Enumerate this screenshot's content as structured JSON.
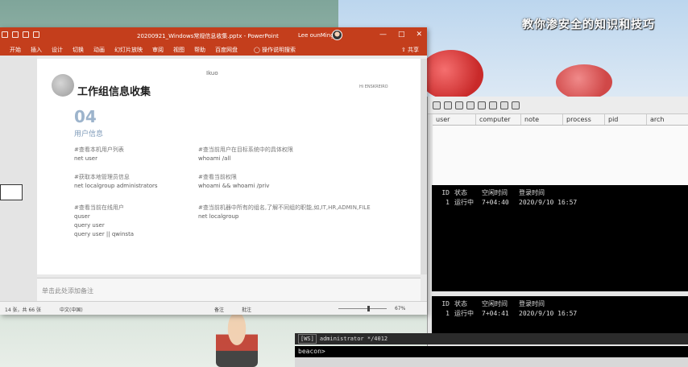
{
  "watermark": "教你渗安全的知识和技巧",
  "powerpoint": {
    "title": "20200921_Windows常规信息收集.pptx - PowerPoint",
    "user": "Lee ounMing",
    "window_controls": [
      "—",
      "□",
      "✕"
    ],
    "ribbon_tabs": [
      "开始",
      "插入",
      "设计",
      "切换",
      "动画",
      "幻灯片放映",
      "审阅",
      "视图",
      "帮助",
      "百度网盘"
    ],
    "search": "操作说明搜索",
    "share": "共享",
    "slide": {
      "heading": "工作组信息收集",
      "number": "04",
      "subtitle": "用户信息",
      "cursor_text": "Ikuo",
      "logo_text": "Hi ENSKREIRO",
      "sections": [
        {
          "title": "#查看本机用户列表",
          "lines": [
            "net user"
          ]
        },
        {
          "title": "#获取本地管理员信息",
          "lines": [
            "net localgroup administrators"
          ]
        },
        {
          "title": "#查看当前在线用户",
          "lines": [
            "quser",
            "query user",
            "query user || qwinsta"
          ]
        },
        {
          "title": "#查当前用户在目标系统中的具体权限",
          "lines": [
            "whoami /all"
          ]
        },
        {
          "title": "#查看当前权限",
          "lines": [
            "whoami && whoami /priv"
          ]
        },
        {
          "title": "#查当前机器中所有的组名,了解不同组的职能,如,IT,HR,ADMIN,FILE",
          "lines": [
            "net localgroup"
          ]
        }
      ]
    },
    "notes_placeholder": "单击此处添加备注",
    "status": {
      "slide_info": "14 张，共 66 张",
      "language": "中文(中国)",
      "notes_button": "备注",
      "comments_button": "批注",
      "zoom": "67%"
    }
  },
  "beacon": {
    "table_columns": [
      "user",
      "computer",
      "note",
      "process",
      "pid",
      "arch"
    ],
    "console_headers": [
      "ID",
      "状态",
      "空闲时间",
      "登录时间"
    ],
    "console_row_1": [
      "1",
      "运行中",
      "7+04:40",
      "2020/9/10 16:57"
    ],
    "console_row_2": [
      "1",
      "运行中",
      "7+04:41",
      "2020/9/10 16:57"
    ],
    "status_tag": "[WS]",
    "status_text": "administrator */4012",
    "prompt": "beacon>"
  }
}
